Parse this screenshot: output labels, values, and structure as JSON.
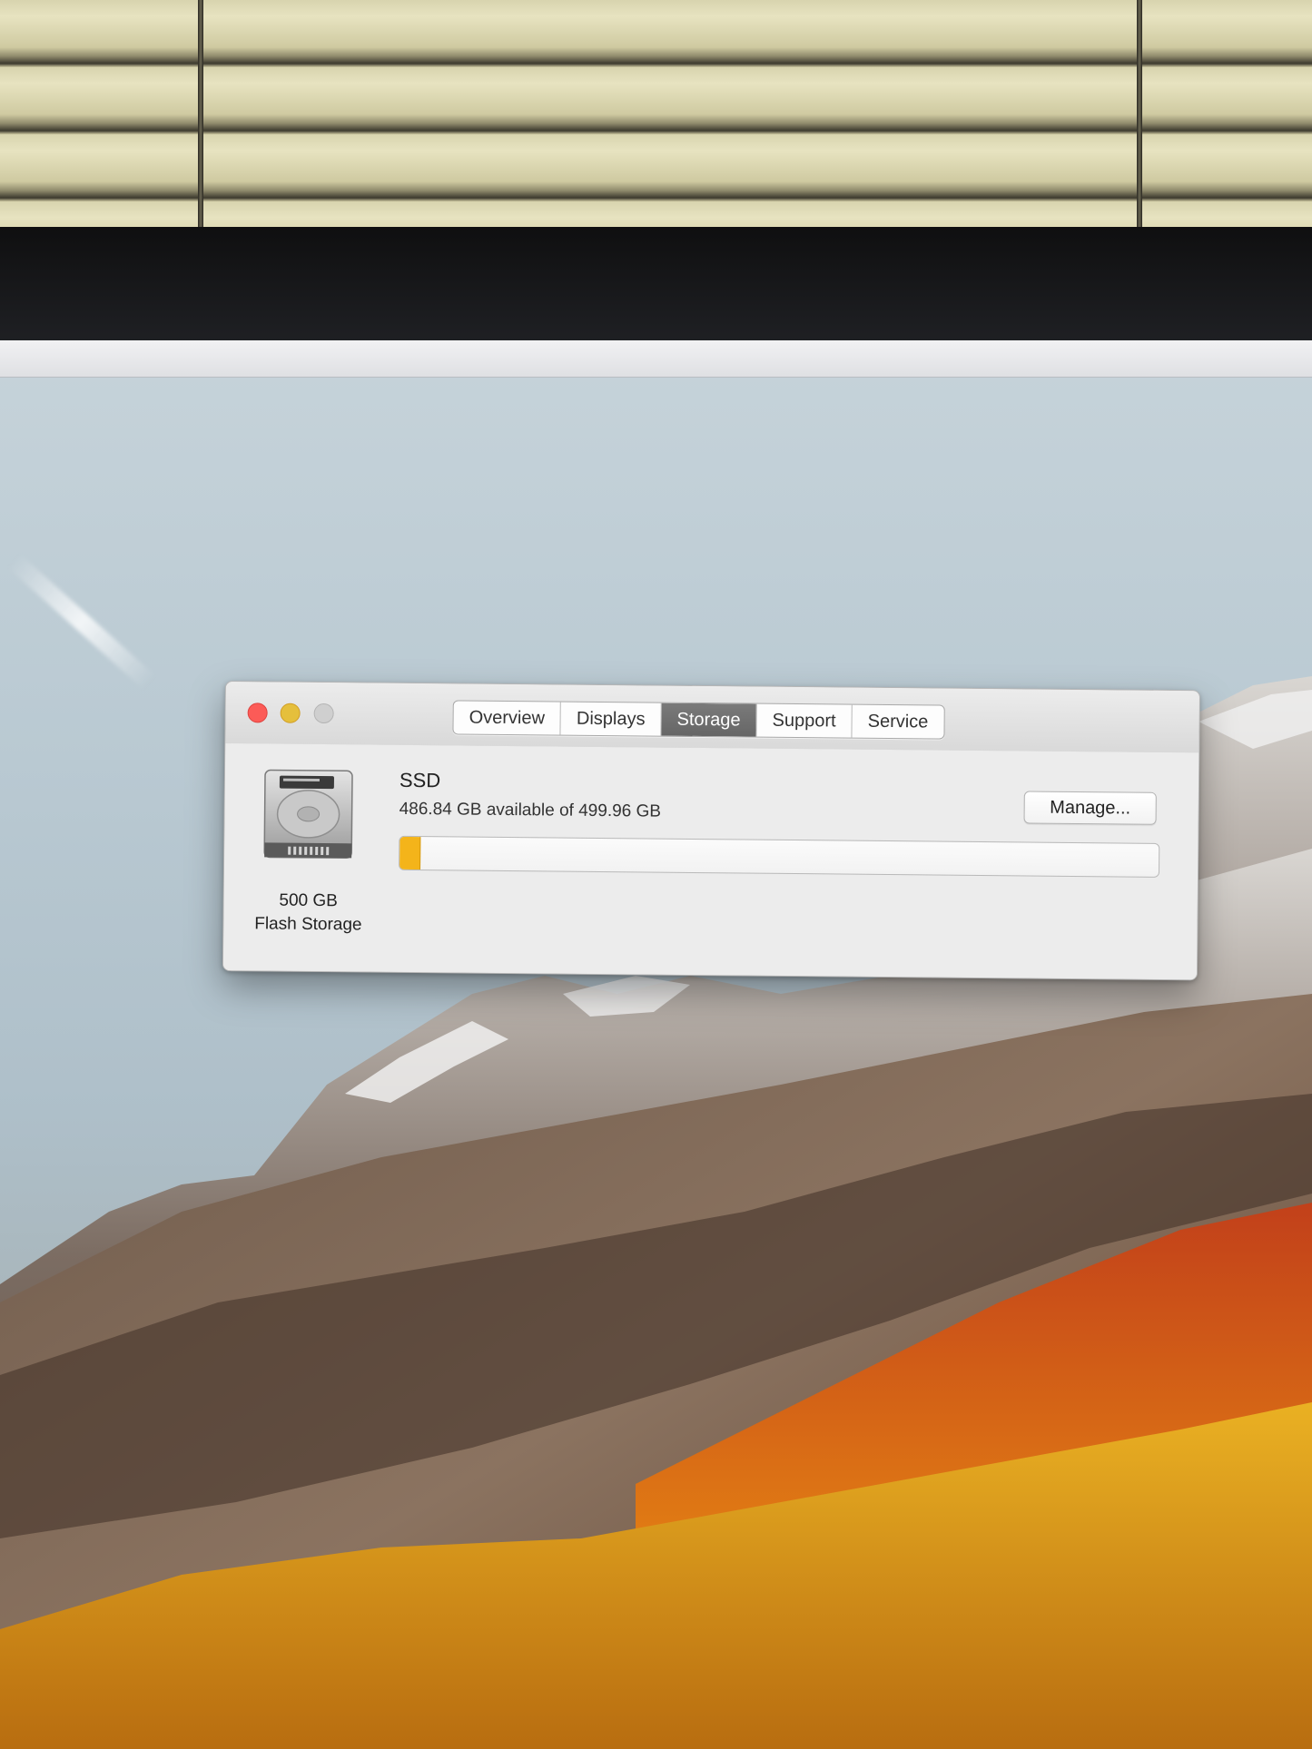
{
  "tabs": [
    {
      "label": "Overview",
      "active": false
    },
    {
      "label": "Displays",
      "active": false
    },
    {
      "label": "Storage",
      "active": true
    },
    {
      "label": "Support",
      "active": false
    },
    {
      "label": "Service",
      "active": false
    }
  ],
  "drive": {
    "capacity_label": "500 GB",
    "type_label": "Flash Storage",
    "name": "SSD",
    "usage_text": "486.84 GB available of 499.96 GB",
    "used_fraction": 0.026,
    "used_color": "#f4b41a"
  },
  "buttons": {
    "manage_label": "Manage..."
  },
  "icons": {
    "drive": "hard-drive-icon",
    "close": "close-icon",
    "minimize": "minimize-icon",
    "zoom": "zoom-icon"
  }
}
